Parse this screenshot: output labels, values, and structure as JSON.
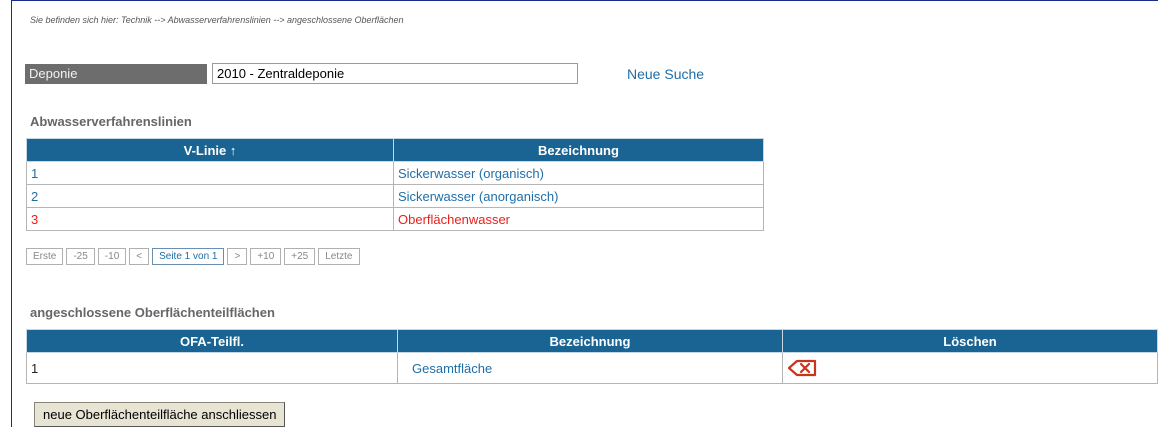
{
  "breadcrumb": "Sie befinden sich hier: Technik --> Abwasserverfahrenslinien --> angeschlossene Oberflächen",
  "search": {
    "label": "Deponie",
    "value": "2010 - Zentraldeponie",
    "new_search": "Neue Suche"
  },
  "lines_section": {
    "title": "Abwasserverfahrenslinien",
    "headers": [
      "V-Linie ↑",
      "Bezeichnung"
    ],
    "rows": [
      {
        "id": "1",
        "name": "Sickerwasser (organisch)",
        "selected": false
      },
      {
        "id": "2",
        "name": "Sickerwasser (anorganisch)",
        "selected": false
      },
      {
        "id": "3",
        "name": "Oberflächenwasser",
        "selected": true
      }
    ],
    "pager": [
      "Erste",
      "-25",
      "-10",
      "<",
      "Seite 1 von 1",
      ">",
      "+10",
      "+25",
      "Letzte"
    ],
    "pager_current_index": 4
  },
  "surfaces_section": {
    "title": "angeschlossene Oberflächenteilflächen",
    "headers": [
      "OFA-Teilfl.",
      "Bezeichnung",
      "Löschen"
    ],
    "rows": [
      {
        "id": "1",
        "name": "Gesamtfläche",
        "delete_icon": "delete-icon"
      }
    ],
    "add_button": "neue Oberflächenteilfläche anschliessen"
  },
  "colors": {
    "header_bg": "#1a6494",
    "link": "#1f6ea8",
    "selected": "#e8211c",
    "delete_icon": "#c8341c"
  }
}
